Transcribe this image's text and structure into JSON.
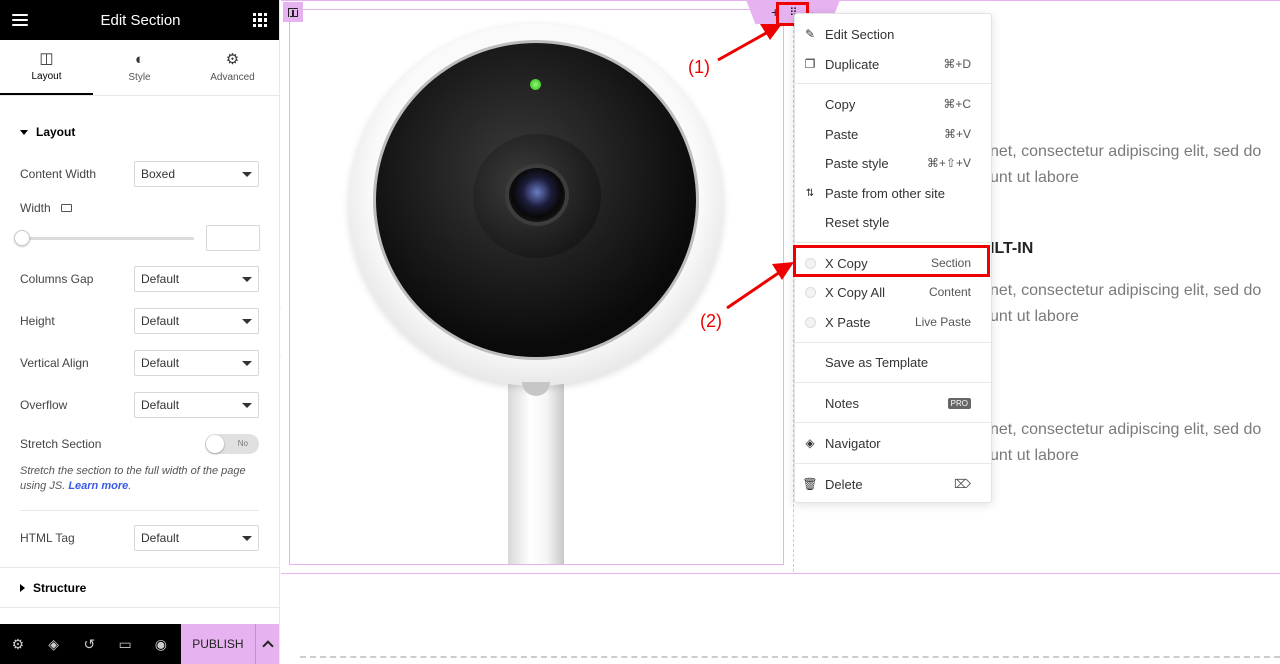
{
  "panel": {
    "title": "Edit Section",
    "menu_icon": "hamburger-icon",
    "apps_icon": "grid-icon",
    "tabs": [
      {
        "label": "Layout",
        "icon": "layout-icon",
        "active": true
      },
      {
        "label": "Style",
        "icon": "style-icon",
        "active": false
      },
      {
        "label": "Advanced",
        "icon": "gear-icon",
        "active": false
      }
    ],
    "section_layout": "Layout",
    "controls": {
      "content_width": {
        "label": "Content Width",
        "value": "Boxed"
      },
      "width": {
        "label": "Width",
        "value": ""
      },
      "columns_gap": {
        "label": "Columns Gap",
        "value": "Default"
      },
      "height": {
        "label": "Height",
        "value": "Default"
      },
      "vertical_align": {
        "label": "Vertical Align",
        "value": "Default"
      },
      "overflow": {
        "label": "Overflow",
        "value": "Default"
      },
      "stretch_section": {
        "label": "Stretch Section",
        "toggle": "No"
      },
      "stretch_hint": "Stretch the section to the full width of the page using JS.",
      "learn_more": "Learn more",
      "html_tag": {
        "label": "HTML Tag",
        "value": "Default"
      }
    },
    "section_structure": "Structure",
    "publish": "PUBLISH"
  },
  "menu": {
    "items": [
      {
        "label": "Edit Section",
        "shortcut": "",
        "icon": "pencil-icon"
      },
      {
        "label": "Duplicate",
        "shortcut": "⌘+D",
        "icon": "duplicate-icon"
      },
      {
        "label": "Copy",
        "shortcut": "⌘+C",
        "icon": ""
      },
      {
        "label": "Paste",
        "shortcut": "⌘+V",
        "icon": ""
      },
      {
        "label": "Paste style",
        "shortcut": "⌘+⇧+V",
        "icon": ""
      },
      {
        "label": "Paste from other site",
        "shortcut": "",
        "icon": "sort-arrows-icon"
      },
      {
        "label": "Reset style",
        "shortcut": "",
        "icon": ""
      },
      {
        "label": "X Copy",
        "shortcut": "Section",
        "icon": "xcopy-icon"
      },
      {
        "label": "X Copy All",
        "shortcut": "Content",
        "icon": "xcopy-icon"
      },
      {
        "label": "X Paste",
        "shortcut": "Live Paste",
        "icon": "xcopy-icon"
      },
      {
        "label": "Save as Template",
        "shortcut": "",
        "icon": ""
      },
      {
        "label": "Notes",
        "shortcut": "PRO",
        "icon": ""
      },
      {
        "label": "Navigator",
        "shortcut": "",
        "icon": "layers-icon"
      },
      {
        "label": "Delete",
        "shortcut": "⌦",
        "icon": "trash-icon"
      }
    ]
  },
  "annotations": {
    "one": "(1)",
    "two": "(2)"
  },
  "content": {
    "line1a": "net, consectetur adipiscing elit, sed do",
    "line1b": "unt ut labore",
    "heading": "ILT-IN",
    "line2a": "net, consectetur adipiscing elit, sed do",
    "line2b": "unt ut labore",
    "line3a": "net, consectetur adipiscing elit, sed do",
    "line3b": "unt ut labore"
  },
  "colors": {
    "accent": "#e6b3f0",
    "annotation": "#ee0000",
    "link": "#3858e9"
  }
}
